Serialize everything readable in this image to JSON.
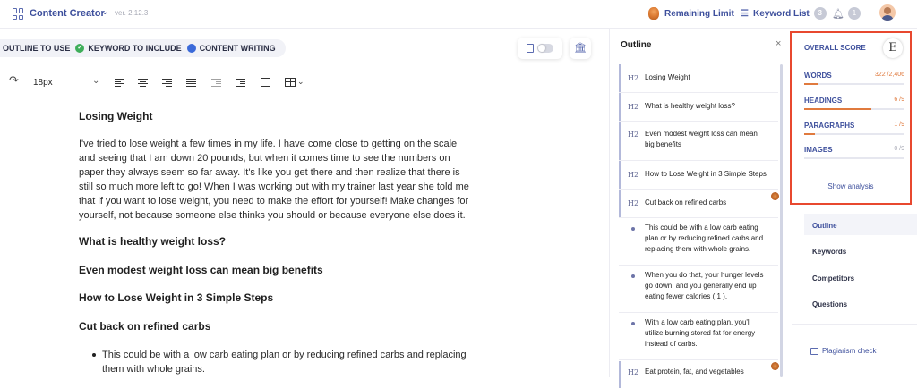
{
  "app": {
    "title": "Content Creator",
    "version": "ver. 2.12.3"
  },
  "header": {
    "remaining_limit": "Remaining Limit",
    "keyword_list": "Keyword List",
    "keyword_count": "3",
    "notification_count": "1"
  },
  "tabs": [
    {
      "label": "OUTLINE TO USE"
    },
    {
      "label": "KEYWORD TO INCLUDE"
    },
    {
      "label": "CONTENT WRITING"
    }
  ],
  "toolbar": {
    "font_size": "18px"
  },
  "editor": {
    "title": "Losing Weight",
    "paragraph": " I've tried to lose weight a few times in my life. I have come close to getting on the scale and seeing that I am down 20 pounds, but when it comes time to see the numbers on paper they always seem so far away. It's like you get there and then realize that there is still so much more left to go! When I was working out with my trainer last year she told me that if you want to lose weight, you need to make the effort for yourself! Make changes for yourself, not because someone else thinks you should or because everyone else does it.",
    "headings": [
      "What is healthy weight loss?",
      "Even modest weight loss can mean big benefits",
      "How to Lose Weight in 3 Simple Steps",
      "Cut back on refined carbs"
    ],
    "bullet": "This could be with a low carb eating plan or by reducing refined carbs and replacing them with whole grains."
  },
  "outline": {
    "title": "Outline",
    "items": [
      {
        "level": "H2",
        "text": "Losing Weight"
      },
      {
        "level": "H2",
        "text": "What is healthy weight loss?"
      },
      {
        "level": "H2",
        "text": "Even modest weight loss can mean big benefits"
      },
      {
        "level": "H2",
        "text": "How to Lose Weight in 3 Simple Steps"
      },
      {
        "level": "H2",
        "text": "Cut back on refined carbs"
      },
      {
        "level": "",
        "text": "This could be with a low carb eating plan or by reducing refined carbs and replacing them with whole grains."
      },
      {
        "level": "",
        "text": "When you do that, your hunger levels go down, and you generally end up eating fewer calories ( 1 )."
      },
      {
        "level": "",
        "text": "With a low carb eating plan, you'll utilize burning stored fat for energy instead of carbs."
      },
      {
        "level": "H2",
        "text": "Eat protein, fat, and vegetables"
      }
    ]
  },
  "score": {
    "title": "OVERALL SCORE",
    "grade": "E",
    "words_label": "WORDS",
    "words_value": "322 /2,406",
    "words_progress": 0.134,
    "headings_label": "HEADINGS",
    "headings_value": "6 /9",
    "headings_progress": 0.667,
    "paragraphs_label": "PARAGRAPHS",
    "paragraphs_value": "1 /9",
    "paragraphs_progress": 0.111,
    "images_label": "IMAGES",
    "images_value": "0 /9",
    "images_progress": 0,
    "show_analysis": "Show analysis"
  },
  "right_nav": {
    "outline": "Outline",
    "keywords": "Keywords",
    "competitors": "Competitors",
    "questions": "Questions",
    "plagiarism": "Plagiarism check"
  },
  "colors": {
    "accent": "#3d4f9c",
    "highlight_border": "#e8482f",
    "progress": "#e07a3e"
  }
}
